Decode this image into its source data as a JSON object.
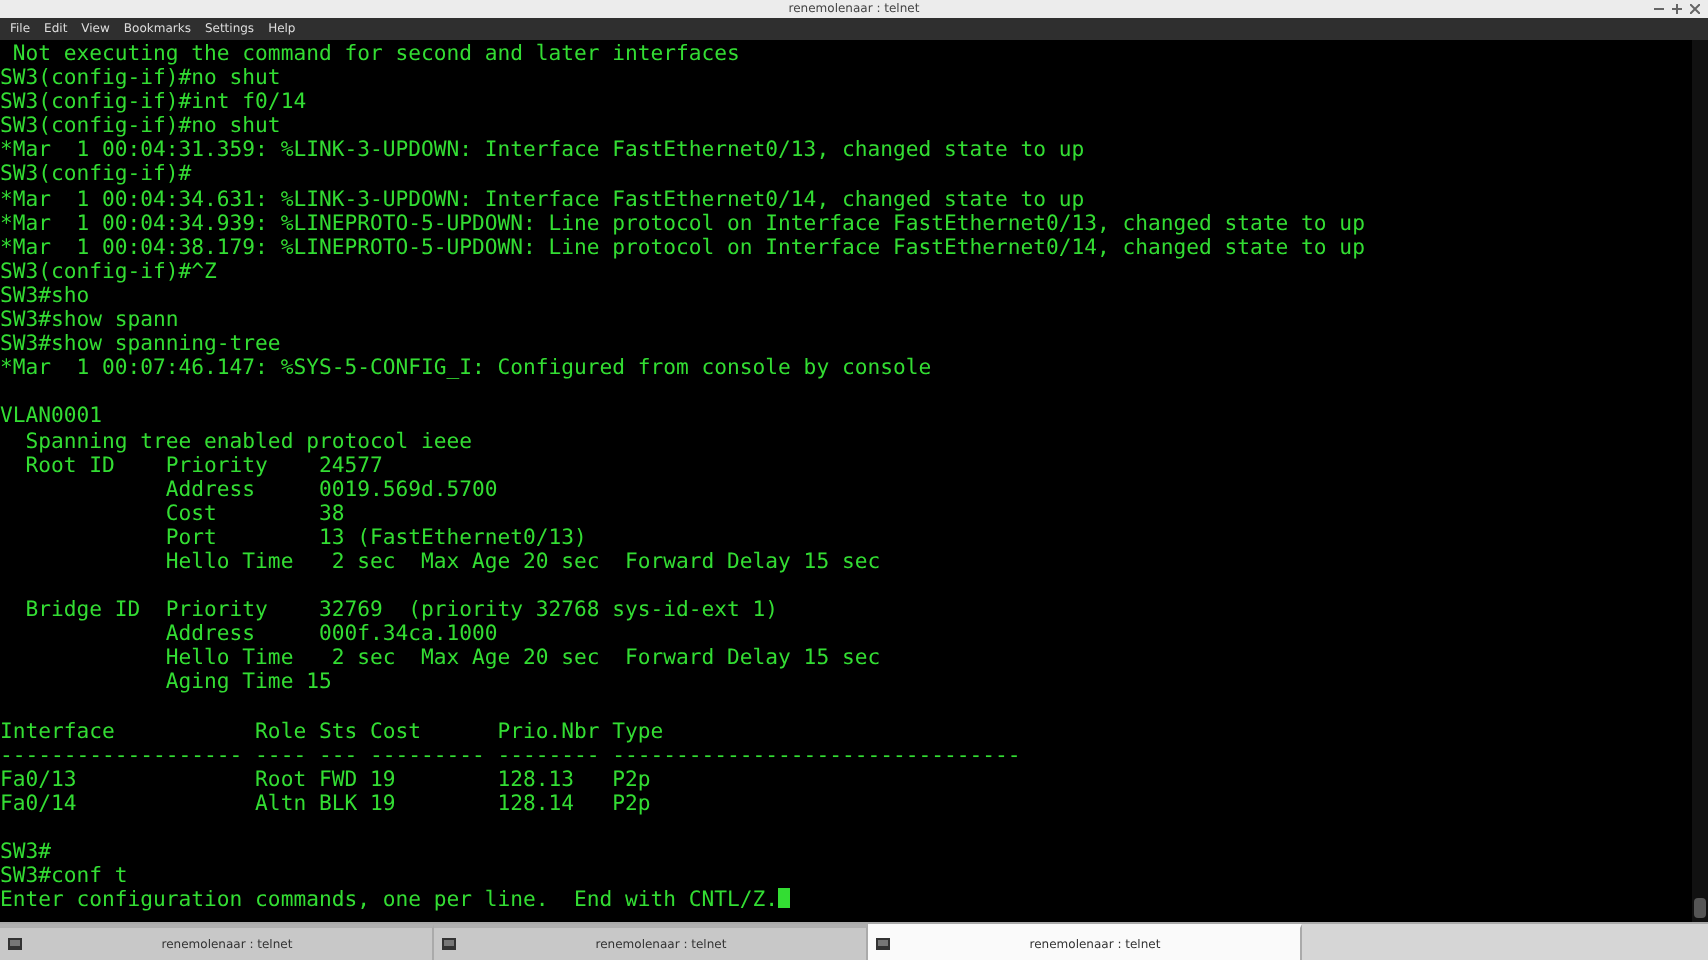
{
  "window": {
    "title": "renemolenaar : telnet"
  },
  "menu": [
    "File",
    "Edit",
    "View",
    "Bookmarks",
    "Settings",
    "Help"
  ],
  "terminal": {
    "blocks": [
      [
        " Not executing the command for second and later interfaces",
        "SW3(config-if)#no shut",
        "SW3(config-if)#int f0/14",
        "SW3(config-if)#no shut",
        "*Mar  1 00:04:31.359: %LINK-3-UPDOWN: Interface FastEthernet0/13, changed state to up",
        "SW3(config-if)#",
        "*Mar  1 00:04:34.631: %LINK-3-UPDOWN: Interface FastEthernet0/14, changed state to up",
        "*Mar  1 00:04:34.939: %LINEPROTO-5-UPDOWN: Line protocol on Interface FastEthernet0/13, changed state to up",
        "*Mar  1 00:04:38.179: %LINEPROTO-5-UPDOWN: Line protocol on Interface FastEthernet0/14, changed state to up",
        "SW3(config-if)#^Z",
        "SW3#sho",
        "SW3#show spann",
        "SW3#show spanning-tree",
        "*Mar  1 00:07:46.147: %SYS-5-CONFIG_I: Configured from console by console"
      ],
      [
        "VLAN0001",
        "  Spanning tree enabled protocol ieee",
        "  Root ID    Priority    24577",
        "             Address     0019.569d.5700",
        "             Cost        38",
        "             Port        13 (FastEthernet0/13)",
        "             Hello Time   2 sec  Max Age 20 sec  Forward Delay 15 sec"
      ],
      [
        "  Bridge ID  Priority    32769  (priority 32768 sys-id-ext 1)",
        "             Address     000f.34ca.1000",
        "             Hello Time   2 sec  Max Age 20 sec  Forward Delay 15 sec",
        "             Aging Time 15"
      ],
      [
        "Interface           Role Sts Cost      Prio.Nbr Type",
        "------------------- ---- --- --------- -------- --------------------------------",
        "Fa0/13              Root FWD 19        128.13   P2p",
        "Fa0/14              Altn BLK 19        128.14   P2p"
      ],
      [
        "SW3#",
        "SW3#conf t",
        "Enter configuration commands, one per line.  End with CNTL/Z."
      ]
    ]
  },
  "tabs": [
    {
      "label": "renemolenaar : telnet",
      "selected": false
    },
    {
      "label": "renemolenaar : telnet",
      "selected": false
    },
    {
      "label": "renemolenaar : telnet",
      "selected": true
    }
  ]
}
